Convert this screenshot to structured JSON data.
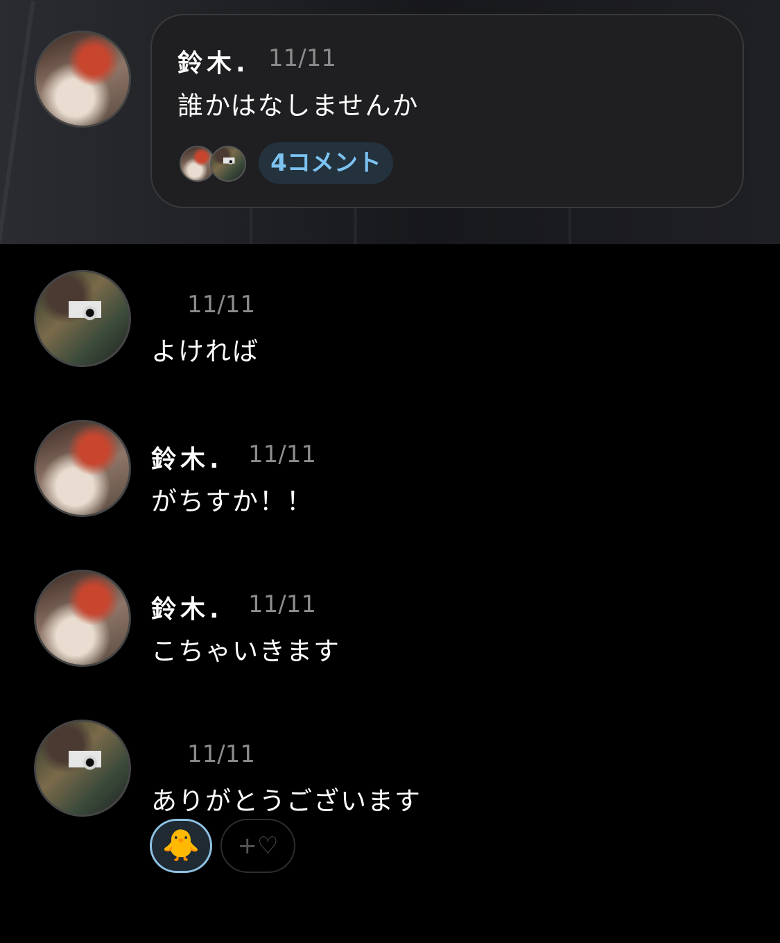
{
  "post": {
    "author": "鈴木.",
    "date": "11/11",
    "text": "誰かはなしませんか",
    "comments_label": "4コメント",
    "commenter_avatars": [
      "avatar-red-hair",
      "avatar-camera"
    ]
  },
  "comments": [
    {
      "author": "",
      "avatar": "avatar-camera",
      "date": "11/11",
      "text": "よければ"
    },
    {
      "author": "鈴木.",
      "avatar": "avatar-red-hair",
      "date": "11/11",
      "text": "がちすか！！"
    },
    {
      "author": "鈴木.",
      "avatar": "avatar-red-hair",
      "date": "11/11",
      "text": "こちゃいきます"
    },
    {
      "author": "",
      "avatar": "avatar-camera",
      "date": "11/11",
      "text": "ありがとうございます"
    }
  ],
  "reactions": {
    "emoji": "🐥",
    "add_label": "+♡"
  },
  "colors": {
    "background": "#000000",
    "card": "#1f1f21",
    "accent": "#7cc3f2",
    "muted": "#8c8c8c"
  }
}
